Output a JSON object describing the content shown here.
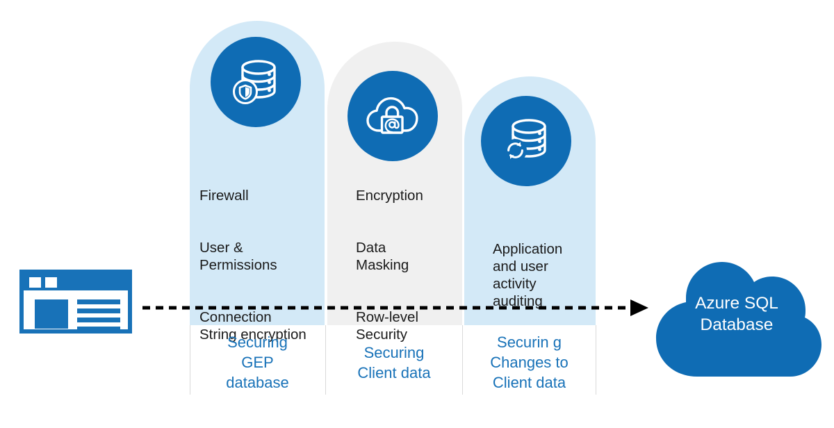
{
  "theme": {
    "accent_blue": "#0f6cb4",
    "caption_blue": "#1872b8",
    "pill_light_blue": "#d3e9f7",
    "pill_gray": "#f0f0f0",
    "text_dark": "#1a1a1a",
    "divider_gray": "#d9d9d9",
    "arrow_black": "#000000",
    "cloud_blue": "#0f6cb4",
    "cloud_text": "#ffffff"
  },
  "source": {
    "icon": "browser-window-icon",
    "label": ""
  },
  "flow": {
    "arrow": "dashed-arrow-right"
  },
  "columns": [
    {
      "id": "securing-gep-database",
      "icon": "database-shield-icon",
      "features": [
        "Firewall",
        "User &\nPermissions",
        "Connection\nString encryption"
      ],
      "caption": "Securing\nGEP\ndatabase"
    },
    {
      "id": "securing-client-data",
      "icon": "cloud-lock-icon",
      "features": [
        "Encryption",
        "Data\nMasking",
        "Row-level\nSecurity"
      ],
      "caption": "Securing\nClient data"
    },
    {
      "id": "securing-changes-to-client-data",
      "icon": "database-sync-icon",
      "features": [
        "Application\nand user\nactivity\nauditing"
      ],
      "caption": "Securin g\nChanges to\nClient data"
    }
  ],
  "destination": {
    "icon": "cloud-icon",
    "label": "Azure SQL\nDatabase"
  }
}
